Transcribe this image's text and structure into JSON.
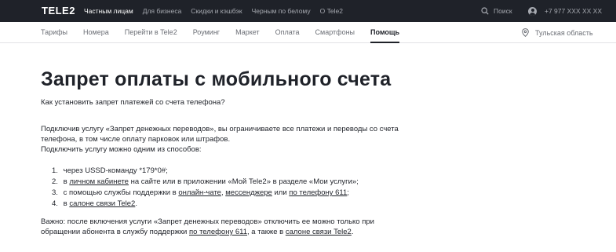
{
  "header": {
    "logo": "TELE2",
    "nav": [
      "Частным лицам",
      "Для бизнеса",
      "Скидки и кэшбэк",
      "Черным по белому",
      "О Tele2"
    ],
    "search_label": "Поиск",
    "phone": "+7 977 XXX XX XX"
  },
  "subnav": {
    "links": [
      "Тарифы",
      "Номера",
      "Перейти в Tele2",
      "Роуминг",
      "Маркет",
      "Оплата",
      "Смартфоны",
      "Помощь"
    ],
    "active_link": "Помощь",
    "region": "Тульская область"
  },
  "article": {
    "title": "Запрет оплаты с мобильного счета",
    "question": "Как установить запрет платежей со счета телефона?",
    "paragraph_line1": "Подключив услугу «Запрет денежных переводов», вы ограничиваете все платежи и переводы со счета",
    "paragraph_line2": "телефона, в том числе оплату парковок или штрафов.",
    "paragraph_line3": "Подключить услугу можно одним из способов:",
    "methods": {
      "m1_num": "1.",
      "m1_text": "через USSD-команду *179*0#;",
      "m2_num": "2.",
      "m2_pre": "в",
      "m2_link": "личном кабинете",
      "m2_post": "на сайте или в приложении «Мой Tele2» в разделе «Мои услуги»;",
      "m3_num": "3.",
      "m3_pre": "с помощью службы поддержки в",
      "m3_link1": "онлайн-чате",
      "m3_sep1": ",",
      "m3_link2": "мессенджере",
      "m3_sep2": "или",
      "m3_link3": "по телефону 611",
      "m3_end": ";",
      "m4_num": "4.",
      "m4_pre": "в",
      "m4_link": "салоне связи Tele2",
      "m4_end": "."
    },
    "note_line1": "Важно: после включения услуги «Запрет денежных переводов» отключить ее можно только при",
    "note_pre": "обращении абонента в службу поддержки",
    "note_link1": "по телефону 611",
    "note_mid": ", а также в",
    "note_link2": "салоне связи Tele2",
    "note_end": "."
  }
}
